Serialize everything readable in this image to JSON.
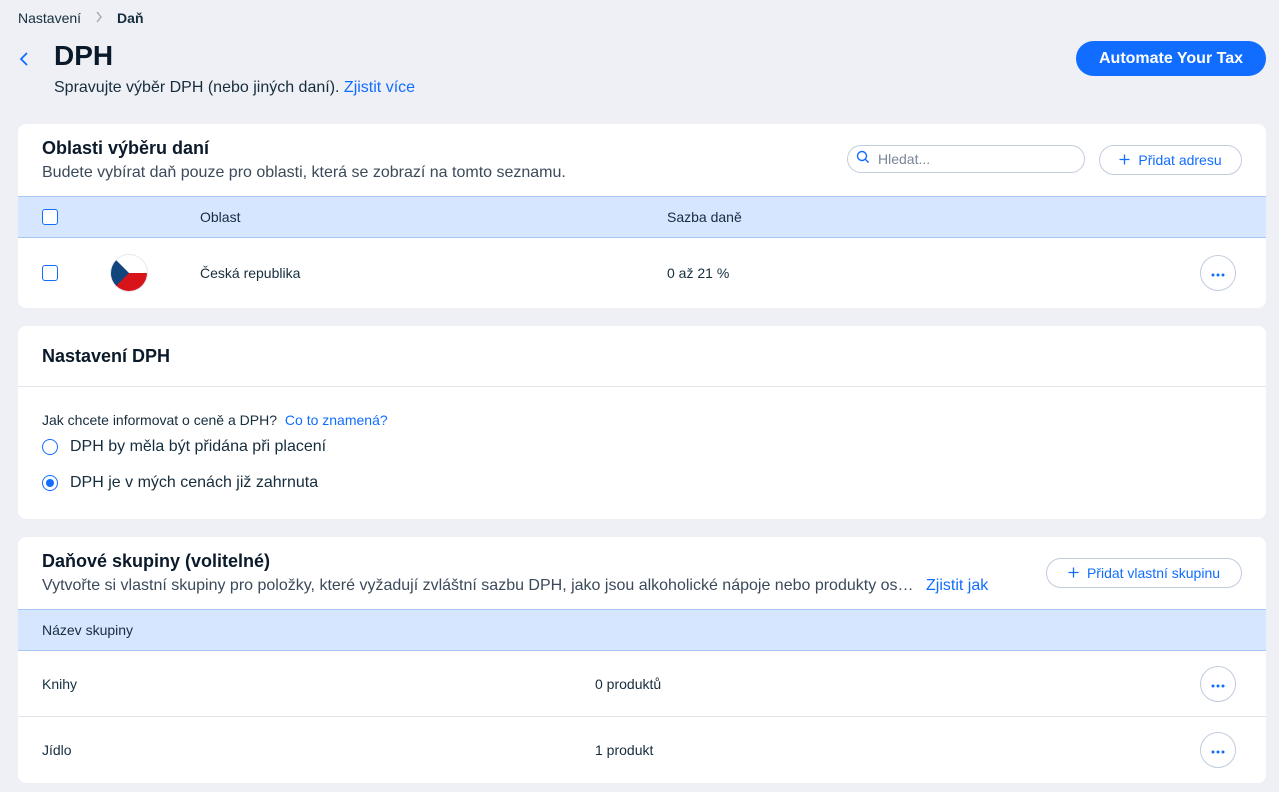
{
  "breadcrumb": {
    "parent": "Nastavení",
    "current": "Daň"
  },
  "header": {
    "title": "DPH",
    "subtitle": "Spravujte výběr DPH (nebo jiných daní).",
    "learn_more": "Zjistit více",
    "automate_button": "Automate Your Tax"
  },
  "regions": {
    "title": "Oblasti výběru daní",
    "description": "Budete vybírat daň pouze pro oblasti, která se zobrazí na tomto seznamu.",
    "search_placeholder": "Hledat...",
    "add_button": "Přidat adresu",
    "columns": {
      "region": "Oblast",
      "rate": "Sazba daně"
    },
    "rows": [
      {
        "flag": "czech-flag",
        "name": "Česká republika",
        "rate": "0 až 21 %"
      }
    ]
  },
  "vat_settings": {
    "title": "Nastavení DPH",
    "question": "Jak chcete informovat o ceně a DPH?",
    "question_link": "Co to znamená?",
    "options": [
      {
        "label": "DPH by měla být přidána při placení",
        "selected": false
      },
      {
        "label": "DPH je v mých cenách již zahrnuta",
        "selected": true
      }
    ]
  },
  "groups": {
    "title": "Daňové skupiny (volitelné)",
    "description": "Vytvořte si vlastní skupiny pro položky, které vyžadují zvláštní sazbu DPH, jako jsou alkoholické nápoje nebo produkty os…",
    "learn_link": "Zjistit jak",
    "add_button": "Přidat vlastní skupinu",
    "column": "Název skupiny",
    "rows": [
      {
        "name": "Knihy",
        "count": "0 produktů"
      },
      {
        "name": "Jídlo",
        "count": "1 produkt"
      }
    ]
  },
  "colors": {
    "accent": "#116dff",
    "table_header": "#d6e6fe",
    "background": "#eef0f5"
  }
}
